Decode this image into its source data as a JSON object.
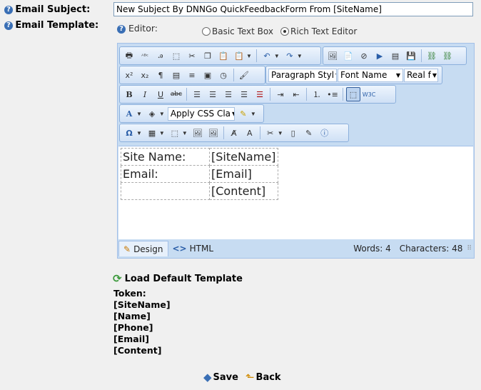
{
  "form": {
    "subject_label": "Email Subject:",
    "subject_value": "New Subject By DNNGo QuickFeedbackForm From [SiteName]",
    "template_label": "Email Template:",
    "editor_label": "Editor:",
    "radio_basic": "Basic Text Box",
    "radio_rich": "Rich Text Editor",
    "selected_editor": "Rich Text Editor"
  },
  "toolbar": {
    "paragraph_style": "Paragraph Styl",
    "font_name": "Font Name",
    "font_size": "Real f",
    "css_class": "Apply CSS Cla",
    "icons_row1": [
      "print-icon",
      "spellcheck-icon",
      "find-replace-icon",
      "select-all-icon",
      "cut-icon",
      "copy-icon",
      "paste-icon",
      "paste-options-icon",
      "undo-icon",
      "redo-icon",
      "image-manager-icon",
      "document-manager-icon",
      "flash-manager-icon",
      "media-manager-icon",
      "template-manager-icon",
      "save-template-icon",
      "hyperlink-icon",
      "remove-link-icon"
    ],
    "icons_row2": [
      "superscript-icon",
      "subscript-icon",
      "paragraph-icon",
      "insert-paragraph-icon",
      "horizontal-rule-icon",
      "format-stripper-icon",
      "insert-date-icon",
      "format-painter-icon"
    ],
    "icons_row3": [
      "bold-icon",
      "italic-icon",
      "underline-icon",
      "strikethrough-icon",
      "align-left-icon",
      "align-center-icon",
      "align-right-icon",
      "justify-icon",
      "remove-alignment-icon",
      "indent-icon",
      "outdent-icon",
      "numbered-list-icon",
      "bulleted-list-icon",
      "toggle-border-icon",
      "xhtml-validator-icon"
    ],
    "icons_row4": [
      "foreground-color-icon",
      "background-color-icon",
      "css-class-icon",
      "format-code-icon"
    ],
    "icons_row5": [
      "special-characters-icon",
      "insert-table-icon",
      "insert-snippet-icon",
      "image-map-icon",
      "absolute-position-icon",
      "module-manager-icon",
      "spell-format-icon",
      "custom-links-icon",
      "template-icon",
      "insert-form-icon",
      "about-icon"
    ]
  },
  "content": {
    "rows": [
      {
        "label": "Site Name:",
        "token": "[SiteName]"
      },
      {
        "label": "Email:",
        "token": "[Email]"
      },
      {
        "label": "",
        "token": "[Content]"
      }
    ]
  },
  "status": {
    "design_tab": "Design",
    "html_tab": "HTML",
    "words": "Words: 4",
    "characters": "Characters: 48"
  },
  "template": {
    "load_default": "Load Default Template",
    "token_heading": "Token:",
    "tokens": [
      "[SiteName]",
      "[Name]",
      "[Phone]",
      "[Email]",
      "[Content]"
    ]
  },
  "actions": {
    "save": "Save",
    "back": "Back"
  },
  "colors": {
    "editor_bg": "#c7dcf2",
    "help_icon": "#3a6fb5",
    "refresh_icon": "#3c9a3c",
    "input_border": "#7f9db9"
  }
}
